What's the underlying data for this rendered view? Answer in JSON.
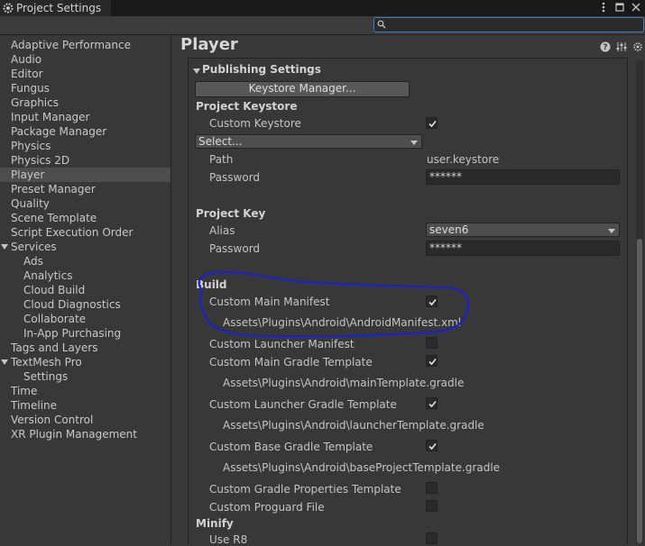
{
  "window": {
    "tab_title": "Project Settings"
  },
  "sidebar": {
    "items": [
      {
        "label": "Adaptive Performance"
      },
      {
        "label": "Audio"
      },
      {
        "label": "Editor"
      },
      {
        "label": "Fungus"
      },
      {
        "label": "Graphics"
      },
      {
        "label": "Input Manager"
      },
      {
        "label": "Package Manager"
      },
      {
        "label": "Physics"
      },
      {
        "label": "Physics 2D"
      },
      {
        "label": "Player",
        "selected": true
      },
      {
        "label": "Preset Manager"
      },
      {
        "label": "Quality"
      },
      {
        "label": "Scene Template"
      },
      {
        "label": "Script Execution Order"
      },
      {
        "label": "Services",
        "expanded": true
      },
      {
        "label": "Ads"
      },
      {
        "label": "Analytics"
      },
      {
        "label": "Cloud Build"
      },
      {
        "label": "Cloud Diagnostics"
      },
      {
        "label": "Collaborate"
      },
      {
        "label": "In-App Purchasing"
      },
      {
        "label": "Tags and Layers"
      },
      {
        "label": "TextMesh Pro",
        "expanded": true
      },
      {
        "label": "Settings"
      },
      {
        "label": "Time"
      },
      {
        "label": "Timeline"
      },
      {
        "label": "Version Control"
      },
      {
        "label": "XR Plugin Management"
      }
    ]
  },
  "main": {
    "title": "Player",
    "publishing": {
      "header": "Publishing Settings",
      "keystore_manager_button": "Keystore Manager...",
      "project_keystore": {
        "header": "Project Keystore",
        "custom_keystore_label": "Custom Keystore",
        "custom_keystore_checked": true,
        "select_dropdown": "Select...",
        "path_label": "Path",
        "path_value": "user.keystore",
        "password_label": "Password",
        "password_value": "******"
      },
      "project_key": {
        "header": "Project Key",
        "alias_label": "Alias",
        "alias_value": "seven6",
        "password_label": "Password",
        "password_value": "******"
      },
      "build": {
        "header": "Build",
        "custom_main_manifest_label": "Custom Main Manifest",
        "custom_main_manifest_checked": true,
        "custom_main_manifest_path": "Assets\\Plugins\\Android\\AndroidManifest.xml",
        "custom_launcher_manifest_label": "Custom Launcher Manifest",
        "custom_launcher_manifest_checked": false,
        "custom_main_gradle_label": "Custom Main Gradle Template",
        "custom_main_gradle_checked": true,
        "custom_main_gradle_path": "Assets\\Plugins\\Android\\mainTemplate.gradle",
        "custom_launcher_gradle_label": "Custom Launcher Gradle Template",
        "custom_launcher_gradle_checked": true,
        "custom_launcher_gradle_path": "Assets\\Plugins\\Android\\launcherTemplate.gradle",
        "custom_base_gradle_label": "Custom Base Gradle Template",
        "custom_base_gradle_checked": true,
        "custom_base_gradle_path": "Assets\\Plugins\\Android\\baseProjectTemplate.gradle",
        "custom_gradle_properties_label": "Custom Gradle Properties Template",
        "custom_gradle_properties_checked": false,
        "custom_proguard_label": "Custom Proguard File",
        "custom_proguard_checked": false
      },
      "minify": {
        "header": "Minify",
        "use_r8_label": "Use R8",
        "use_r8_checked": false
      }
    }
  },
  "icons": {
    "tab_icon": "gear-icon",
    "window_menu": "kebab-menu-icon",
    "maximize": "maximize-icon",
    "close": "close-icon",
    "search": "search-icon",
    "help": "help-icon",
    "presets": "sliders-icon",
    "settings": "gear-icon"
  },
  "colors": {
    "annotation_ink": "#1a22c8",
    "search_focus": "#3a79bb",
    "selection": "#4d4d4d"
  }
}
